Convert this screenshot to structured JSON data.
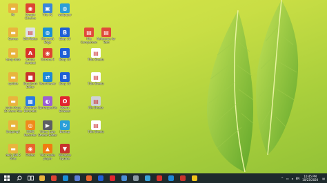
{
  "desktop": {
    "icons": [
      {
        "label": "Mr",
        "color": "#e8b53d",
        "glyph": "▬",
        "icon": "folder-icon"
      },
      {
        "label": "Google Chrome",
        "color": "#dd4433",
        "glyph": "◉",
        "icon": "chrome-icon"
      },
      {
        "label": "This PC",
        "color": "#3a86d8",
        "glyph": "▣",
        "icon": "pc-icon"
      },
      {
        "label": "wallpaper",
        "color": "#2a9fd8",
        "glyph": "◍",
        "icon": "edge-icon"
      },
      {
        "label": "Games",
        "color": "#e8b53d",
        "glyph": "▬",
        "icon": "folder-icon"
      },
      {
        "label": "Edit Notes",
        "color": "#dfe3e6",
        "glyph": "▤",
        "icon": "file-icon"
      },
      {
        "label": "Microsoft Edge",
        "color": "#1a8fd6",
        "glyph": "◍",
        "icon": "edge-icon"
      },
      {
        "label": "Ebay 10",
        "color": "#1f5fd6",
        "glyph": "B",
        "icon": "app-icon"
      },
      {
        "label": "File Comparison",
        "color": "#e04a3a",
        "glyph": "▤",
        "icon": "pdf-icon"
      },
      {
        "label": "Reference for Tech",
        "color": "#e04a3a",
        "glyph": "▤",
        "icon": "pdf-icon"
      },
      {
        "label": "temp data",
        "color": "#e8b53d",
        "glyph": "▬",
        "icon": "folder-icon"
      },
      {
        "label": "Adobe Acrobat",
        "color": "#d8322a",
        "glyph": "A",
        "icon": "acrobat-icon"
      },
      {
        "label": "Chrome 9",
        "color": "#dd4433",
        "glyph": "◉",
        "icon": "chrome-icon"
      },
      {
        "label": "Ebay 10",
        "color": "#1f5fd6",
        "glyph": "B",
        "icon": "app-icon"
      },
      {
        "label": "Title Sheets",
        "color": "#ffffff",
        "glyph": "▤",
        "icon": "pdf-icon"
      },
      {
        "label": "update",
        "color": "#e8b53d",
        "glyph": "▬",
        "icon": "folder-icon"
      },
      {
        "label": "Bandicam Editor",
        "color": "#c8332c",
        "glyph": "■",
        "icon": "recorder-icon"
      },
      {
        "label": "TeamViewer",
        "color": "#1d89d6",
        "glyph": "⇄",
        "icon": "teamviewer-icon"
      },
      {
        "label": "Ebay 10",
        "color": "#1f5fd6",
        "glyph": "B",
        "icon": "app-icon"
      },
      {
        "label": "Title Sheets",
        "color": "#ffffff",
        "glyph": "▤",
        "icon": "pdf-icon"
      },
      {
        "label": "main clone 10 clone files",
        "color": "#e8b53d",
        "glyph": "▬",
        "icon": "folder-icon"
      },
      {
        "label": "Windows Defender",
        "color": "#2b7be0",
        "glyph": "▦",
        "icon": "shield-icon"
      },
      {
        "label": "Epmarguerite",
        "color": "#9b5fd2",
        "glyph": "◐",
        "icon": "app-icon"
      },
      {
        "label": "Opera Browser",
        "color": "#e2262f",
        "glyph": "O",
        "icon": "opera-icon"
      },
      {
        "label": "File Sheets",
        "color": "#cfd2d6",
        "glyph": "▤",
        "icon": "file-icon"
      },
      {
        "label": "Snipping1",
        "color": "#e8b53d",
        "glyph": "▬",
        "icon": "folder-icon"
      },
      {
        "label": "SSMS Recorder",
        "color": "#f08a1c",
        "glyph": "◎",
        "icon": "recorder-icon"
      },
      {
        "label": "Video Tube Stretch Editor",
        "color": "#5d5f63",
        "glyph": "▶",
        "icon": "video-icon"
      },
      {
        "label": "Backup",
        "color": "#2a9fd8",
        "glyph": "↻",
        "icon": "sync-icon"
      },
      {
        "label": "Title Sheets",
        "color": "#ffffff",
        "glyph": "▤",
        "icon": "pdf-icon"
      },
      {
        "label": "daily JAN 2 time",
        "color": "#e8b53d",
        "glyph": "▬",
        "icon": "folder-icon"
      },
      {
        "label": "Firefox",
        "color": "#e8652c",
        "glyph": "◉",
        "icon": "firefox-icon"
      },
      {
        "label": "VLC media player",
        "color": "#f07d10",
        "glyph": "▲",
        "icon": "vlc-icon"
      },
      {
        "label": "Windows Update",
        "color": "#c8332c",
        "glyph": "▼",
        "icon": "download-icon"
      }
    ]
  },
  "taskbar": {
    "start_icon": "windows-logo-icon",
    "pinned": [
      {
        "icon": "file-explorer-icon",
        "color": "#e8b53d"
      },
      {
        "icon": "chrome-icon",
        "color": "#dd4433"
      },
      {
        "icon": "edge-icon",
        "color": "#1a8fd6"
      },
      {
        "icon": "store-icon",
        "color": "#5d7fd6"
      },
      {
        "icon": "firefox-icon",
        "color": "#e8652c"
      },
      {
        "icon": "ebay-icon",
        "color": "#1f5fd6"
      },
      {
        "icon": "opera-icon",
        "color": "#e2262f"
      },
      {
        "icon": "mail-icon",
        "color": "#4b8fd6"
      },
      {
        "icon": "settings-icon",
        "color": "#8a9aa3"
      },
      {
        "icon": "photos-icon",
        "color": "#3aa3d8"
      },
      {
        "icon": "acrobat-icon",
        "color": "#d8322a"
      },
      {
        "icon": "teamviewer-icon",
        "color": "#1d89d6"
      },
      {
        "icon": "recorder-icon",
        "color": "#c8332c"
      },
      {
        "icon": "notes-icon",
        "color": "#f0c419"
      }
    ],
    "tray": {
      "lang": "EN",
      "time": "10:45 PM",
      "date": "10/23/2020"
    }
  }
}
